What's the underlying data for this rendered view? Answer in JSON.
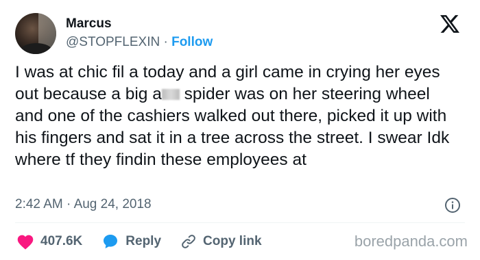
{
  "user": {
    "name": "Marcus",
    "handle": "@STOPFLEXIN",
    "separator": "·",
    "follow_label": "Follow"
  },
  "tweet": {
    "text_before": "I was at chic fil a today and a girl came in crying her eyes out because a big a",
    "text_after": " spider was on her steering wheel and one of the cashiers walked out there, picked it up with his fingers and sat it in a tree across the street. I swear Idk where tf they findin these employees at",
    "time": "2:42 AM",
    "separator": "·",
    "date": "Aug 24, 2018"
  },
  "actions": {
    "like_count": "407.6K",
    "reply_label": "Reply",
    "copy_label": "Copy link"
  },
  "watermark": "boredpanda.com",
  "colors": {
    "accent": "#1d9bf0",
    "like": "#f91880",
    "text": "#0f1419",
    "muted": "#536471"
  },
  "icons": [
    "x-logo-icon",
    "info-icon",
    "heart-icon",
    "reply-bubble-icon",
    "link-icon"
  ]
}
